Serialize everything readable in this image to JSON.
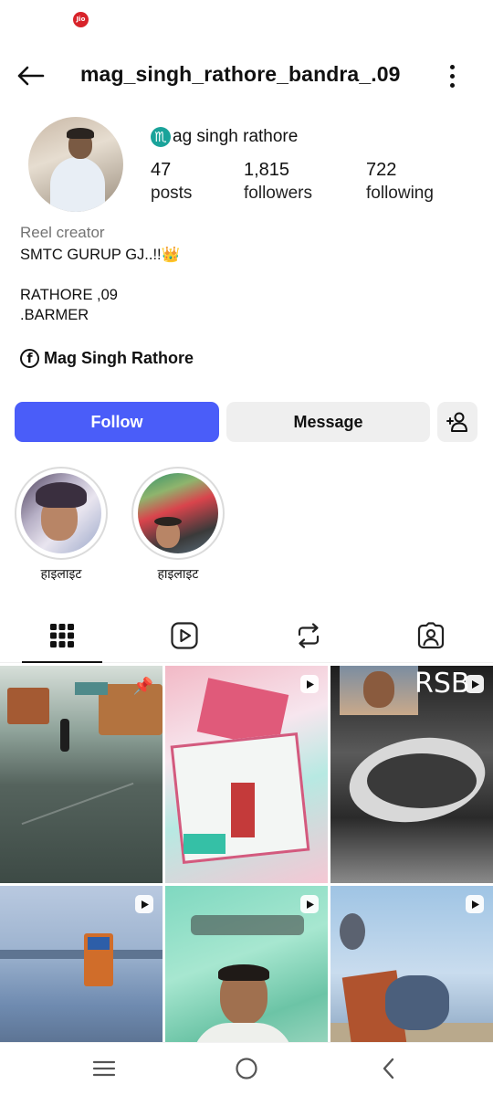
{
  "status_bar": {
    "carrier_icon": "jio-icon",
    "carrier_text": "Jio"
  },
  "header": {
    "back_icon": "arrow-left-icon",
    "username": "mag_singh_rathore_bandra_.09",
    "more_icon": "more-vertical-icon"
  },
  "profile": {
    "display_name_icon": "scorpio-zodiac-icon",
    "display_name_icon_glyph": "♏",
    "display_name": "ag singh rathore",
    "stats": [
      {
        "value": "47",
        "label": "posts"
      },
      {
        "value": "1,815",
        "label": "followers"
      },
      {
        "value": "722",
        "label": "following"
      }
    ],
    "category": "Reel creator",
    "bio": [
      "SMTC GURUP GJ..!!👑",
      "RATHORE ,09",
      ".BARMER"
    ],
    "link": {
      "icon": "facebook-icon",
      "icon_glyph": "f",
      "text": "Mag Singh Rathore"
    }
  },
  "actions": {
    "follow_label": "Follow",
    "message_label": "Message",
    "add_user_icon": "add-user-icon",
    "colors": {
      "follow_bg": "#4a5df9",
      "secondary_bg": "#efefef"
    }
  },
  "highlights": [
    {
      "label": "हाइलाइट"
    },
    {
      "label": "हाइलाइट"
    }
  ],
  "tabs": [
    {
      "name": "posts-grid",
      "icon": "grid-icon",
      "active": true
    },
    {
      "name": "reels",
      "icon": "reels-icon",
      "active": false
    },
    {
      "name": "reposts",
      "icon": "repost-icon",
      "active": false
    },
    {
      "name": "tagged",
      "icon": "tagged-icon",
      "active": false
    }
  ],
  "grid": {
    "posts": [
      {
        "type": "pinned",
        "badge": "pin-icon"
      },
      {
        "type": "reel",
        "badge": "reel-icon"
      },
      {
        "type": "reel",
        "badge": "reel-icon",
        "overlay_text": "RSB"
      },
      {
        "type": "reel",
        "badge": "reel-icon"
      },
      {
        "type": "reel",
        "badge": "reel-icon"
      },
      {
        "type": "reel",
        "badge": "reel-icon"
      }
    ]
  },
  "nav_bar": {
    "recents_icon": "recent-apps-icon",
    "home_icon": "home-circle-icon",
    "back_icon": "chevron-left-icon"
  }
}
